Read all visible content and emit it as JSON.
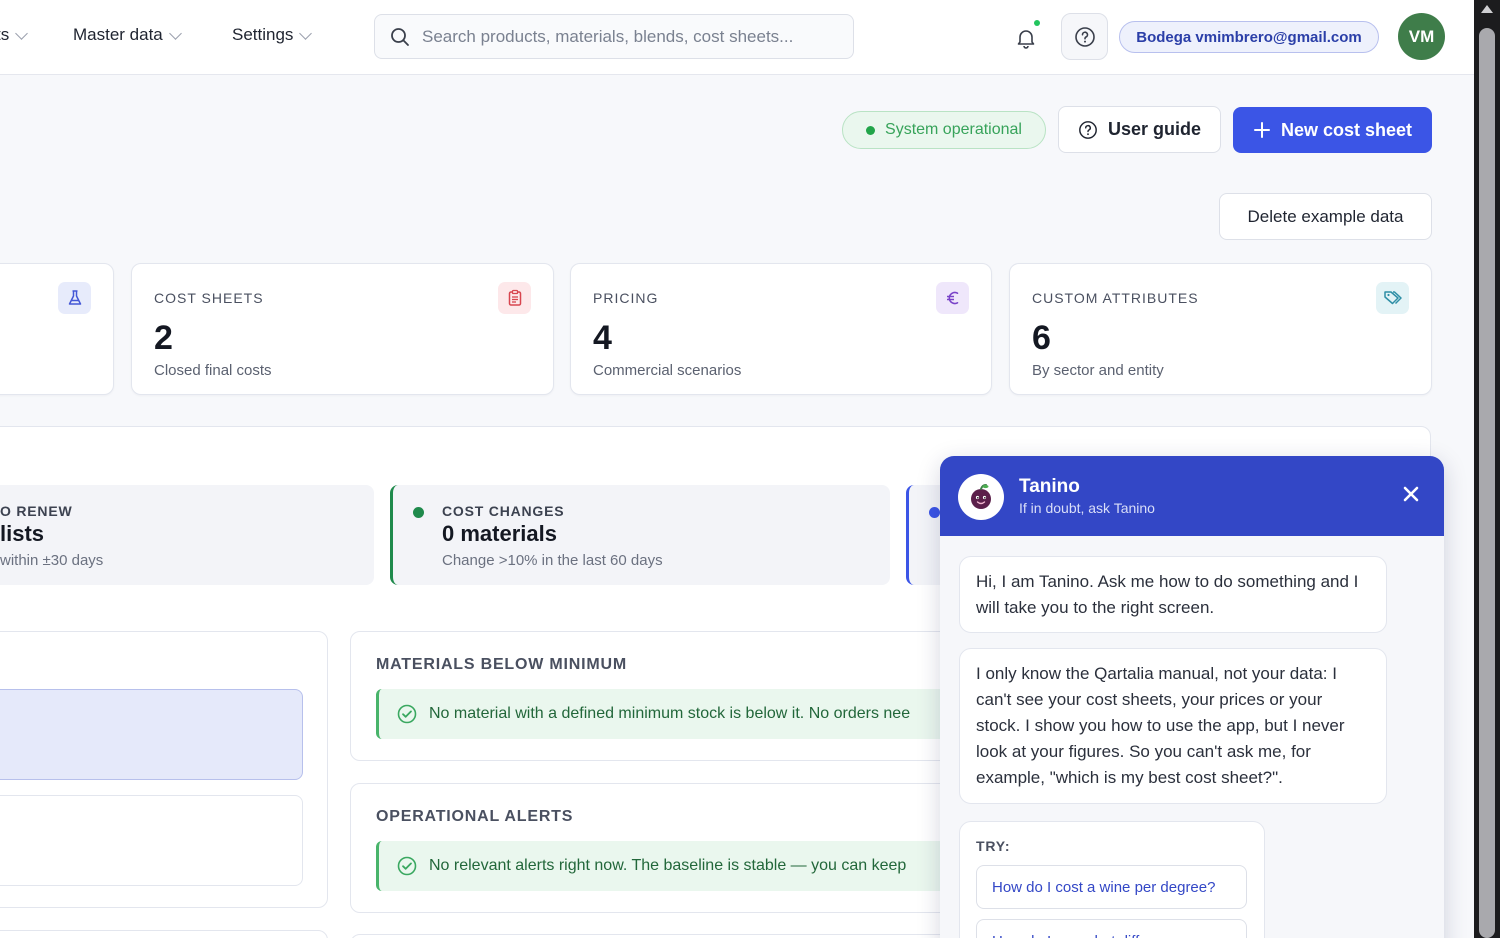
{
  "nav": {
    "items": [
      {
        "label": "ts"
      },
      {
        "label": "Master data"
      },
      {
        "label": "Settings"
      }
    ],
    "search_placeholder": "Search products, materials, blends, cost sheets...",
    "user": "Bodega vmimbrero@gmail.com",
    "avatar": "VM"
  },
  "actions": {
    "status": "System operational",
    "guide": "User guide",
    "new_cost_sheet": "New cost sheet",
    "delete_example": "Delete example data"
  },
  "cards": [
    {
      "label": "COST SHEETS",
      "value": "2",
      "sub": "Closed final costs",
      "icon": "clipboard-icon"
    },
    {
      "label": "PRICING",
      "value": "4",
      "sub": "Commercial scenarios",
      "icon": "euro-icon"
    },
    {
      "label": "CUSTOM ATTRIBUTES",
      "value": "6",
      "sub": "By sector and entity",
      "icon": "tags-icon"
    }
  ],
  "kpis": [
    {
      "label": "O RENEW",
      "value": "lists",
      "sub": "within ±30 days"
    },
    {
      "label": "COST CHANGES",
      "value": "0 materials",
      "sub": "Change >10% in the last 60 days"
    }
  ],
  "panels": {
    "materials": {
      "title": "MATERIALS BELOW MINIMUM",
      "message": "No material with a defined minimum stock is below it. No orders nee"
    },
    "alerts": {
      "title": "OPERATIONAL ALERTS",
      "message": "No relevant alerts right now. The baseline is stable — you can keep"
    }
  },
  "chat": {
    "name": "Tanino",
    "tagline": "If in doubt, ask Tanino",
    "messages": [
      "Hi, I am Tanino. Ask me how to do something and I will take you to the right screen.",
      "I only know the Qartalia manual, not your data: I can't see your cost sheets, your prices or your stock. I show you how to use the app, but I never look at your figures. So you can't ask me, for example, \"which is my best cost sheet?\"."
    ],
    "try_label": "TRY:",
    "suggestions": [
      "How do I cost a wine per degree?",
      "How do I see what differ"
    ]
  },
  "colors": {
    "primary": "#3b55e6",
    "chat_header": "#3347c6",
    "success": "#22a54a",
    "avatar": "#3f7d4a"
  }
}
